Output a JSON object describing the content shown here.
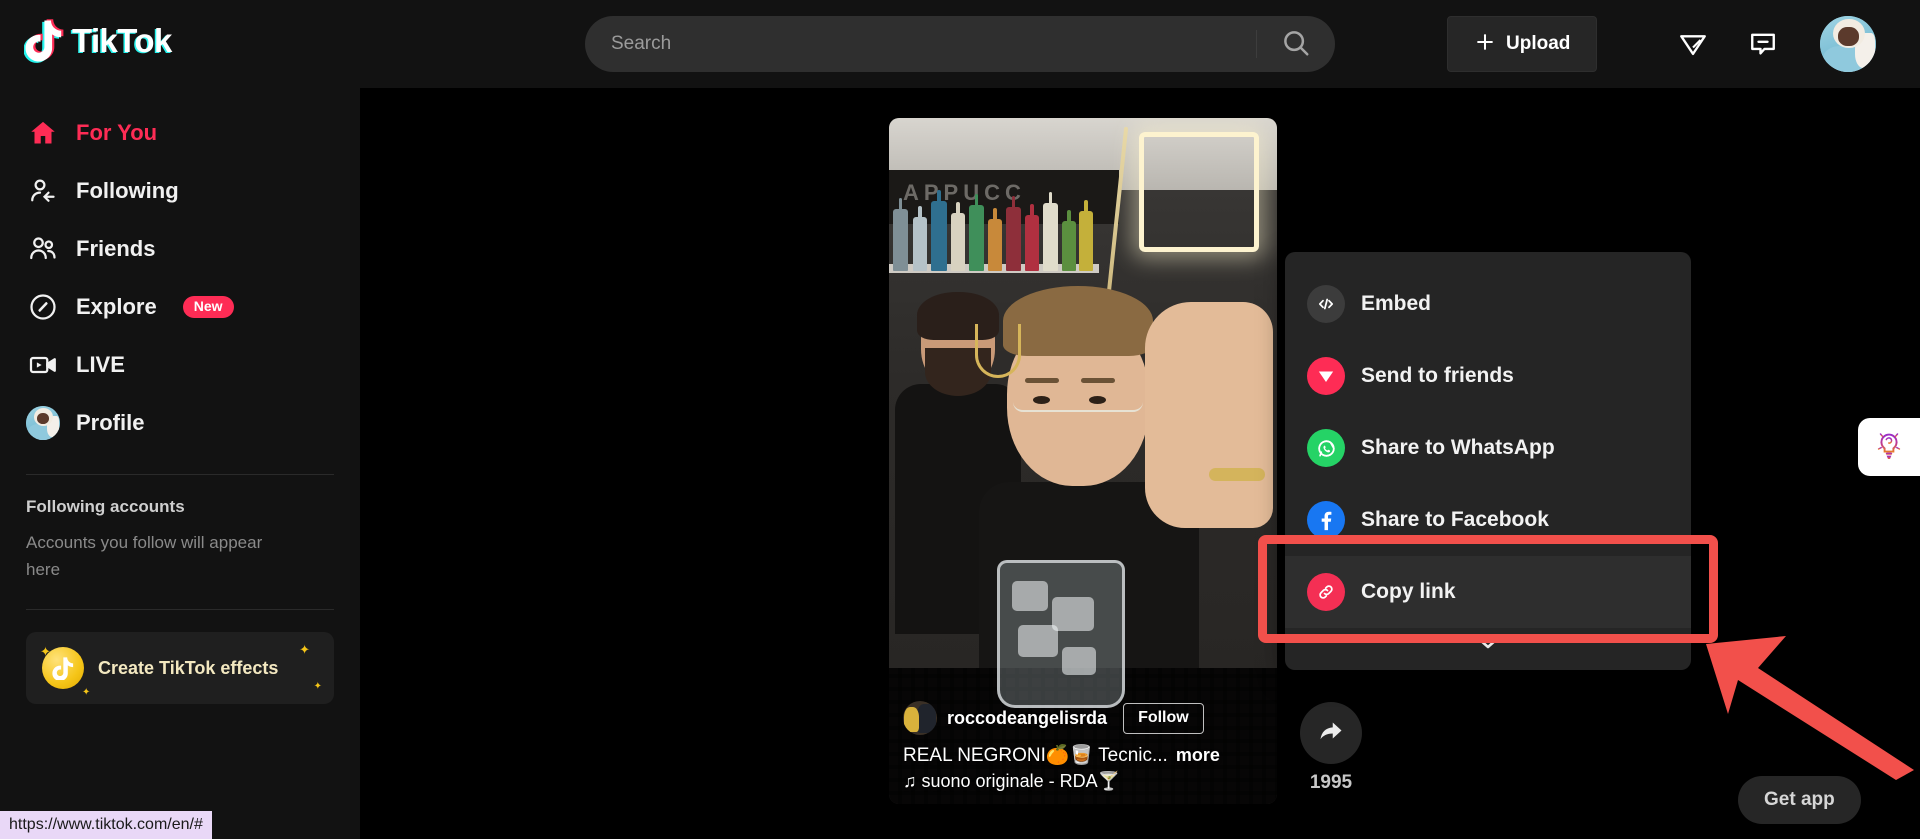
{
  "header": {
    "logo_text": "TikTok",
    "logo_icon": "tiktok-note-icon",
    "search": {
      "placeholder": "Search",
      "value": "",
      "icon": "search-icon"
    },
    "upload": {
      "label": "Upload",
      "icon": "plus-icon"
    },
    "icons": [
      {
        "name": "send-message-icon",
        "label": "Messages"
      },
      {
        "name": "inbox-icon",
        "label": "Inbox"
      }
    ],
    "avatar": {
      "name": "profile-avatar",
      "label": "Account"
    }
  },
  "sidebar": {
    "items": [
      {
        "label": "For You",
        "icon": "home-icon",
        "active": true,
        "badge": ""
      },
      {
        "label": "Following",
        "icon": "following-icon",
        "active": false,
        "badge": ""
      },
      {
        "label": "Friends",
        "icon": "friends-icon",
        "active": false,
        "badge": ""
      },
      {
        "label": "Explore",
        "icon": "compass-icon",
        "active": false,
        "badge": "New"
      },
      {
        "label": "LIVE",
        "icon": "live-icon",
        "active": false,
        "badge": ""
      },
      {
        "label": "Profile",
        "icon": "avatar-icon",
        "active": false,
        "badge": ""
      }
    ],
    "following_heading": "Following accounts",
    "following_sub": "Accounts you follow will appear here",
    "effects_card": {
      "label": "Create TikTok effects",
      "icon": "tiktok-coin-icon"
    }
  },
  "video": {
    "username": "roccodeangelisrda",
    "follow_label": "Follow",
    "caption": "REAL NEGRONI🍊🥃 Tecnic...",
    "more_label": "more",
    "music": "♫ suono originale - RDA🍸",
    "share_count": "1995",
    "share_icon": "share-arrow-icon"
  },
  "share_menu": {
    "items": [
      {
        "label": "Embed",
        "icon": "code-icon",
        "color": "#3c3c3c",
        "highlighted": false
      },
      {
        "label": "Send to friends",
        "icon": "paperplane-icon",
        "color": "#FE2C55",
        "highlighted": false
      },
      {
        "label": "Share to WhatsApp",
        "icon": "whatsapp-icon",
        "color": "#25D366",
        "highlighted": false
      },
      {
        "label": "Share to Facebook",
        "icon": "facebook-icon",
        "color": "#1877F2",
        "highlighted": false
      },
      {
        "label": "Copy link",
        "icon": "link-icon",
        "color": "#F42F54",
        "highlighted": true
      }
    ],
    "expand_icon": "chevron-down-icon"
  },
  "annotation": {
    "color": "#F2504B",
    "target": "Copy link",
    "arrow_icon": "pointer-arrow-icon"
  },
  "floating": {
    "bulb_tab": {
      "icon": "idea-bulb-icon"
    },
    "get_app": {
      "label": "Get app"
    }
  },
  "status_bar": {
    "url": "https://www.tiktok.com/en/#"
  },
  "colors": {
    "brand_red": "#FE2C55",
    "brand_cyan": "#25F4EE",
    "background": "#000000",
    "surface": "#121212",
    "menu_surface": "#252525",
    "annotation_red": "#F2504B"
  }
}
